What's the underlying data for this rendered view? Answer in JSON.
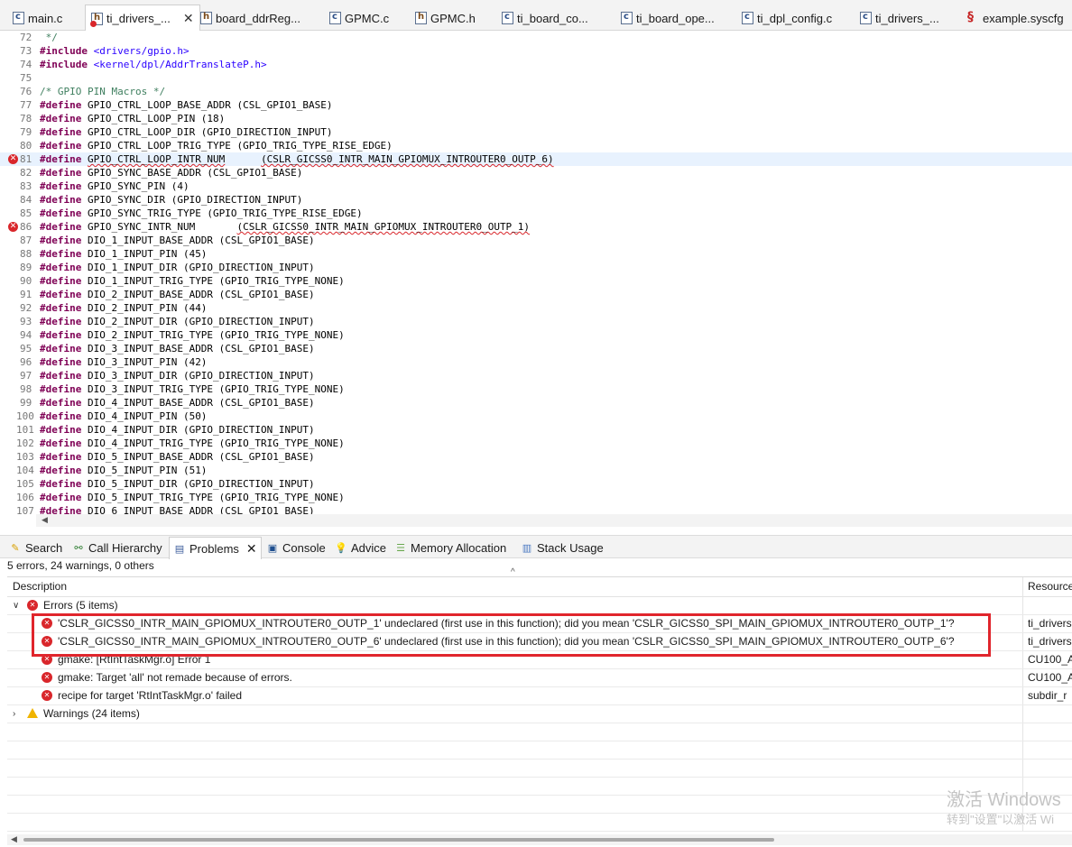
{
  "editor_tabs": [
    {
      "label": "main.c",
      "type": "c"
    },
    {
      "label": "ti_drivers_...",
      "type": "h-error",
      "close": "✕"
    },
    {
      "label": "board_ddrReg...",
      "type": "h"
    },
    {
      "label": "GPMC.c",
      "type": "c"
    },
    {
      "label": "GPMC.h",
      "type": "h"
    },
    {
      "label": "ti_board_co...",
      "type": "c"
    },
    {
      "label": "ti_board_ope...",
      "type": "c"
    },
    {
      "label": "ti_dpl_config.c",
      "type": "c"
    },
    {
      "label": "ti_drivers_...",
      "type": "c"
    },
    {
      "label": "example.syscfg",
      "type": "syscfg"
    }
  ],
  "code_lines": [
    {
      "num": "72",
      "parts": [
        {
          "t": " */",
          "c": "cmt"
        }
      ]
    },
    {
      "num": "73",
      "parts": [
        {
          "t": "#include",
          "c": "kw"
        },
        {
          "t": " "
        },
        {
          "t": "<drivers/gpio.h>",
          "c": "inc"
        }
      ]
    },
    {
      "num": "74",
      "parts": [
        {
          "t": "#include",
          "c": "kw"
        },
        {
          "t": " "
        },
        {
          "t": "<kernel/dpl/AddrTranslateP.h>",
          "c": "inc"
        }
      ]
    },
    {
      "num": "75",
      "parts": []
    },
    {
      "num": "76",
      "parts": [
        {
          "t": "/* GPIO PIN Macros */",
          "c": "cmt"
        }
      ]
    },
    {
      "num": "77",
      "parts": [
        {
          "t": "#define",
          "c": "kw"
        },
        {
          "t": " GPIO_CTRL_LOOP_BASE_ADDR (CSL_GPIO1_BASE)"
        }
      ]
    },
    {
      "num": "78",
      "parts": [
        {
          "t": "#define",
          "c": "kw"
        },
        {
          "t": " GPIO_CTRL_LOOP_PIN (18)"
        }
      ]
    },
    {
      "num": "79",
      "parts": [
        {
          "t": "#define",
          "c": "kw"
        },
        {
          "t": " GPIO_CTRL_LOOP_DIR (GPIO_DIRECTION_INPUT)"
        }
      ]
    },
    {
      "num": "80",
      "parts": [
        {
          "t": "#define",
          "c": "kw"
        },
        {
          "t": " GPIO_CTRL_LOOP_TRIG_TYPE (GPIO_TRIG_TYPE_RISE_EDGE)"
        }
      ]
    },
    {
      "num": "81",
      "error": true,
      "highlight": true,
      "parts": [
        {
          "t": "#define",
          "c": "kw"
        },
        {
          "t": " "
        },
        {
          "t": "GPIO_CTRL_LOOP_INTR_NUM",
          "c": "squig"
        },
        {
          "t": "      "
        },
        {
          "t": "(CSLR_GICSS0_INTR_MAIN_GPIOMUX_INTROUTER0_OUTP_6)",
          "c": "squig"
        }
      ]
    },
    {
      "num": "82",
      "parts": [
        {
          "t": "#define",
          "c": "kw"
        },
        {
          "t": " GPIO_SYNC_BASE_ADDR (CSL_GPIO1_BASE)"
        }
      ]
    },
    {
      "num": "83",
      "parts": [
        {
          "t": "#define",
          "c": "kw"
        },
        {
          "t": " GPIO_SYNC_PIN (4)"
        }
      ]
    },
    {
      "num": "84",
      "parts": [
        {
          "t": "#define",
          "c": "kw"
        },
        {
          "t": " GPIO_SYNC_DIR (GPIO_DIRECTION_INPUT)"
        }
      ]
    },
    {
      "num": "85",
      "parts": [
        {
          "t": "#define",
          "c": "kw"
        },
        {
          "t": " GPIO_SYNC_TRIG_TYPE (GPIO_TRIG_TYPE_RISE_EDGE)"
        }
      ]
    },
    {
      "num": "86",
      "error": true,
      "parts": [
        {
          "t": "#define",
          "c": "kw"
        },
        {
          "t": " GPIO_SYNC_INTR_NUM       "
        },
        {
          "t": "(CSLR_GICSS0_INTR_MAIN_GPIOMUX_INTROUTER0_OUTP_1)",
          "c": "squig"
        }
      ]
    },
    {
      "num": "87",
      "parts": [
        {
          "t": "#define",
          "c": "kw"
        },
        {
          "t": " DIO_1_INPUT_BASE_ADDR (CSL_GPIO1_BASE)"
        }
      ]
    },
    {
      "num": "88",
      "parts": [
        {
          "t": "#define",
          "c": "kw"
        },
        {
          "t": " DIO_1_INPUT_PIN (45)"
        }
      ]
    },
    {
      "num": "89",
      "parts": [
        {
          "t": "#define",
          "c": "kw"
        },
        {
          "t": " DIO_1_INPUT_DIR (GPIO_DIRECTION_INPUT)"
        }
      ]
    },
    {
      "num": "90",
      "parts": [
        {
          "t": "#define",
          "c": "kw"
        },
        {
          "t": " DIO_1_INPUT_TRIG_TYPE (GPIO_TRIG_TYPE_NONE)"
        }
      ]
    },
    {
      "num": "91",
      "parts": [
        {
          "t": "#define",
          "c": "kw"
        },
        {
          "t": " DIO_2_INPUT_BASE_ADDR (CSL_GPIO1_BASE)"
        }
      ]
    },
    {
      "num": "92",
      "parts": [
        {
          "t": "#define",
          "c": "kw"
        },
        {
          "t": " DIO_2_INPUT_PIN (44)"
        }
      ]
    },
    {
      "num": "93",
      "parts": [
        {
          "t": "#define",
          "c": "kw"
        },
        {
          "t": " DIO_2_INPUT_DIR (GPIO_DIRECTION_INPUT)"
        }
      ]
    },
    {
      "num": "94",
      "parts": [
        {
          "t": "#define",
          "c": "kw"
        },
        {
          "t": " DIO_2_INPUT_TRIG_TYPE (GPIO_TRIG_TYPE_NONE)"
        }
      ]
    },
    {
      "num": "95",
      "parts": [
        {
          "t": "#define",
          "c": "kw"
        },
        {
          "t": " DIO_3_INPUT_BASE_ADDR (CSL_GPIO1_BASE)"
        }
      ]
    },
    {
      "num": "96",
      "parts": [
        {
          "t": "#define",
          "c": "kw"
        },
        {
          "t": " DIO_3_INPUT_PIN (42)"
        }
      ]
    },
    {
      "num": "97",
      "parts": [
        {
          "t": "#define",
          "c": "kw"
        },
        {
          "t": " DIO_3_INPUT_DIR (GPIO_DIRECTION_INPUT)"
        }
      ]
    },
    {
      "num": "98",
      "parts": [
        {
          "t": "#define",
          "c": "kw"
        },
        {
          "t": " DIO_3_INPUT_TRIG_TYPE (GPIO_TRIG_TYPE_NONE)"
        }
      ]
    },
    {
      "num": "99",
      "parts": [
        {
          "t": "#define",
          "c": "kw"
        },
        {
          "t": " DIO_4_INPUT_BASE_ADDR (CSL_GPIO1_BASE)"
        }
      ]
    },
    {
      "num": "100",
      "parts": [
        {
          "t": "#define",
          "c": "kw"
        },
        {
          "t": " DIO_4_INPUT_PIN (50)"
        }
      ]
    },
    {
      "num": "101",
      "parts": [
        {
          "t": "#define",
          "c": "kw"
        },
        {
          "t": " DIO_4_INPUT_DIR (GPIO_DIRECTION_INPUT)"
        }
      ]
    },
    {
      "num": "102",
      "parts": [
        {
          "t": "#define",
          "c": "kw"
        },
        {
          "t": " DIO_4_INPUT_TRIG_TYPE (GPIO_TRIG_TYPE_NONE)"
        }
      ]
    },
    {
      "num": "103",
      "parts": [
        {
          "t": "#define",
          "c": "kw"
        },
        {
          "t": " DIO_5_INPUT_BASE_ADDR (CSL_GPIO1_BASE)"
        }
      ]
    },
    {
      "num": "104",
      "parts": [
        {
          "t": "#define",
          "c": "kw"
        },
        {
          "t": " DIO_5_INPUT_PIN (51)"
        }
      ]
    },
    {
      "num": "105",
      "parts": [
        {
          "t": "#define",
          "c": "kw"
        },
        {
          "t": " DIO_5_INPUT_DIR (GPIO_DIRECTION_INPUT)"
        }
      ]
    },
    {
      "num": "106",
      "parts": [
        {
          "t": "#define",
          "c": "kw"
        },
        {
          "t": " DIO_5_INPUT_TRIG_TYPE (GPIO_TRIG_TYPE_NONE)"
        }
      ]
    },
    {
      "num": "107",
      "parts": [
        {
          "t": "#define",
          "c": "kw"
        },
        {
          "t": " DIO_6_INPUT_BASE_ADDR (CSL_GPIO1_BASE)"
        }
      ]
    }
  ],
  "view_tabs": {
    "search": "Search",
    "call_hierarchy": "Call Hierarchy",
    "problems": "Problems",
    "problems_close": "✕",
    "console": "Console",
    "advice": "Advice",
    "memory_allocation": "Memory Allocation",
    "stack_usage": "Stack Usage"
  },
  "problems": {
    "summary": "5 errors, 24 warnings, 0 others",
    "columns": {
      "description": "Description",
      "resource": "Resource"
    },
    "errors_group": "Errors (5 items)",
    "errors": [
      {
        "text": "'CSLR_GICSS0_INTR_MAIN_GPIOMUX_INTROUTER0_OUTP_1' undeclared (first use in this function); did you mean 'CSLR_GICSS0_SPI_MAIN_GPIOMUX_INTROUTER0_OUTP_1'?",
        "resource": "ti_drivers"
      },
      {
        "text": "'CSLR_GICSS0_INTR_MAIN_GPIOMUX_INTROUTER0_OUTP_6' undeclared (first use in this function); did you mean 'CSLR_GICSS0_SPI_MAIN_GPIOMUX_INTROUTER0_OUTP_6'?",
        "resource": "ti_drivers"
      },
      {
        "text": "gmake:      [RtIntTaskMgr.o] Error 1",
        "resource": "CU100_A"
      },
      {
        "text": "gmake: Target 'all' not remade because of errors.",
        "resource": "CU100_A"
      },
      {
        "text": "recipe for target 'RtIntTaskMgr.o' failed",
        "resource": "subdir_r"
      }
    ],
    "warnings_group": "Warnings (24 items)"
  },
  "watermark": {
    "line1": "激活 Windows",
    "line2": "转到\"设置\"以激活 Wi"
  },
  "colors": {
    "error_red": "#d9262b",
    "keyword": "#7f0055",
    "include_string": "#2a00ff",
    "comment": "#3f7f5f",
    "warning_yellow": "#f0b400"
  }
}
